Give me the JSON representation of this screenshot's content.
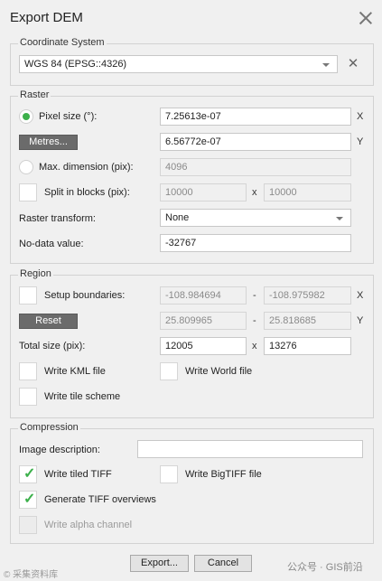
{
  "window": {
    "title": "Export DEM"
  },
  "coordinate_system": {
    "legend": "Coordinate System",
    "value": "WGS 84 (EPSG::4326)"
  },
  "raster": {
    "legend": "Raster",
    "pixel_size_label": "Pixel size (°):",
    "pixel_size_x": "7.25613e-07",
    "pixel_size_y": "6.56772e-07",
    "metres_button": "Metres...",
    "max_dimension_label": "Max. dimension (pix):",
    "max_dimension_value": "4096",
    "split_label": "Split in blocks (pix):",
    "split_x": "10000",
    "split_y": "10000",
    "transform_label": "Raster transform:",
    "transform_value": "None",
    "nodata_label": "No-data value:",
    "nodata_value": "-32767",
    "x_unit": "X",
    "y_unit": "Y",
    "x_sep": "x"
  },
  "region": {
    "legend": "Region",
    "setup_label": "Setup boundaries:",
    "xmin": "-108.984694",
    "xmax": "-108.975982",
    "ymin": "25.809965",
    "ymax": "25.818685",
    "dash": "-",
    "reset_button": "Reset",
    "total_size_label": "Total size (pix):",
    "total_x": "12005",
    "total_y": "13276",
    "write_kml": "Write KML file",
    "write_world": "Write World file",
    "write_tile_scheme": "Write tile scheme"
  },
  "compression": {
    "legend": "Compression",
    "image_description_label": "Image description:",
    "image_description_value": "",
    "write_tiled_tiff": "Write tiled TIFF",
    "write_bigtiff": "Write BigTIFF file",
    "generate_overviews": "Generate TIFF overviews",
    "write_alpha": "Write alpha channel"
  },
  "footer": {
    "export_button": "Export...",
    "cancel_button": "Cancel",
    "watermark_left": "© 采集资料库",
    "watermark_right": "公众号 · GIS前沿"
  },
  "colors": {
    "accent": "#3cb04b",
    "dark_button": "#6b6b6b"
  },
  "state": {
    "pixel_size_radio": true,
    "max_dimension_radio": false,
    "split_checked": false,
    "setup_boundaries_checked": false,
    "write_kml_checked": false,
    "write_world_checked": false,
    "write_tile_scheme_checked": false,
    "write_tiled_tiff_checked": true,
    "write_bigtiff_checked": false,
    "generate_overviews_checked": true,
    "write_alpha_checked": false
  }
}
